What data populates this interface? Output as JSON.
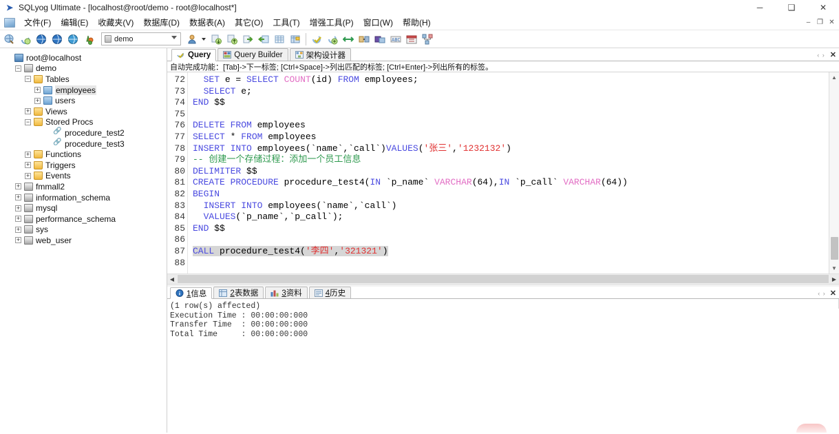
{
  "window": {
    "title": "SQLyog Ultimate - [localhost@root/demo - root@localhost*]",
    "app_icon": "sqlyog-icon",
    "minimize": "─",
    "maximize": "❑",
    "close": "✕",
    "mdi_minimize": "–",
    "mdi_restore": "❐",
    "mdi_close": "✕"
  },
  "menu": {
    "items": [
      {
        "label": "文件(F)",
        "name": "menu-file"
      },
      {
        "label": "编辑(E)",
        "name": "menu-edit"
      },
      {
        "label": "收藏夹(V)",
        "name": "menu-favorites"
      },
      {
        "label": "数据库(D)",
        "name": "menu-database"
      },
      {
        "label": "数据表(A)",
        "name": "menu-table"
      },
      {
        "label": "其它(O)",
        "name": "menu-other"
      },
      {
        "label": "工具(T)",
        "name": "menu-tools"
      },
      {
        "label": "增强工具(P)",
        "name": "menu-powertools"
      },
      {
        "label": "窗口(W)",
        "name": "menu-window"
      },
      {
        "label": "帮助(H)",
        "name": "menu-help"
      }
    ]
  },
  "toolbar": {
    "db_combo_value": "demo",
    "db_combo_placeholder": "demo",
    "buttons": [
      {
        "name": "new-connection-button",
        "icon": "connection-icon"
      },
      {
        "name": "refresh-object-button",
        "icon": "refresh-icon"
      },
      {
        "name": "new-query-tab-button",
        "icon": "globe-blue-icon"
      },
      {
        "name": "open-query-button",
        "icon": "globe-blue2-icon"
      },
      {
        "name": "query-builder-button",
        "icon": "globe-cyan-icon"
      },
      {
        "name": "schema-designer-button",
        "icon": "tree-green-icon"
      }
    ],
    "buttons2": [
      {
        "name": "user-manager-button",
        "icon": "user-icon"
      },
      {
        "name": "import-external-data-button",
        "icon": "import-icon"
      },
      {
        "name": "export-data-button",
        "icon": "export-icon"
      },
      {
        "name": "backup-button",
        "icon": "backup-green-icon"
      },
      {
        "name": "restore-button",
        "icon": "restore-green-icon"
      },
      {
        "name": "table-data-button",
        "icon": "table-grid-icon"
      },
      {
        "name": "table-diagnostics-button",
        "icon": "table-flag-icon"
      }
    ],
    "buttons3": [
      {
        "name": "execute-query-button",
        "icon": "execute-icon"
      },
      {
        "name": "execute-all-button",
        "icon": "execute-all-icon"
      },
      {
        "name": "sync-data-button",
        "icon": "sync-icon"
      },
      {
        "name": "schema-sync-button",
        "icon": "schema-sync-icon"
      },
      {
        "name": "notification-services-button",
        "icon": "notify-icon"
      },
      {
        "name": "sql-formatter-button",
        "icon": "format-icon"
      },
      {
        "name": "scheduled-backup-button",
        "icon": "calendar-icon"
      },
      {
        "name": "migration-button",
        "icon": "migration-icon"
      }
    ]
  },
  "sidebar": {
    "nodes": [
      {
        "label": "root@localhost",
        "indent": 0,
        "expander": "none",
        "icon": "server-icon",
        "name": "tree-node-server"
      },
      {
        "label": "demo",
        "indent": 1,
        "expander": "minus",
        "icon": "db-icon",
        "name": "tree-node-demo"
      },
      {
        "label": "Tables",
        "indent": 2,
        "expander": "minus",
        "icon": "folder-icon",
        "name": "tree-node-tables"
      },
      {
        "label": "employees",
        "indent": 3,
        "expander": "plus",
        "icon": "table-icon",
        "name": "tree-node-employees",
        "selected": true
      },
      {
        "label": "users",
        "indent": 3,
        "expander": "plus",
        "icon": "table-icon",
        "name": "tree-node-users"
      },
      {
        "label": "Views",
        "indent": 2,
        "expander": "plus",
        "icon": "folder-icon",
        "name": "tree-node-views"
      },
      {
        "label": "Stored Procs",
        "indent": 2,
        "expander": "minus",
        "icon": "folder-icon",
        "name": "tree-node-stored-procs"
      },
      {
        "label": "procedure_test2",
        "indent": 4,
        "expander": "none",
        "icon": "proc-icon",
        "name": "tree-node-procedure-test2"
      },
      {
        "label": "procedure_test3",
        "indent": 4,
        "expander": "none",
        "icon": "proc-icon",
        "name": "tree-node-procedure-test3"
      },
      {
        "label": "Functions",
        "indent": 2,
        "expander": "plus",
        "icon": "folder-icon",
        "name": "tree-node-functions"
      },
      {
        "label": "Triggers",
        "indent": 2,
        "expander": "plus",
        "icon": "folder-icon",
        "name": "tree-node-triggers"
      },
      {
        "label": "Events",
        "indent": 2,
        "expander": "plus",
        "icon": "folder-icon",
        "name": "tree-node-events"
      },
      {
        "label": "fmmall2",
        "indent": 1,
        "expander": "plus",
        "icon": "db-icon",
        "name": "tree-node-fmmall2"
      },
      {
        "label": "information_schema",
        "indent": 1,
        "expander": "plus",
        "icon": "db-icon",
        "name": "tree-node-information-schema"
      },
      {
        "label": "mysql",
        "indent": 1,
        "expander": "plus",
        "icon": "db-icon",
        "name": "tree-node-mysql"
      },
      {
        "label": "performance_schema",
        "indent": 1,
        "expander": "plus",
        "icon": "db-icon",
        "name": "tree-node-performance-schema"
      },
      {
        "label": "sys",
        "indent": 1,
        "expander": "plus",
        "icon": "db-icon",
        "name": "tree-node-sys"
      },
      {
        "label": "web_user",
        "indent": 1,
        "expander": "plus",
        "icon": "db-icon",
        "name": "tree-node-web-user"
      }
    ]
  },
  "editor": {
    "tabs": [
      {
        "label": "Query",
        "icon": "query-icon",
        "active": true,
        "name": "tab-query"
      },
      {
        "label": "Query Builder",
        "icon": "query-builder-icon",
        "active": false,
        "name": "tab-query-builder"
      },
      {
        "label": "架构设计器",
        "icon": "schema-designer-icon",
        "active": false,
        "name": "tab-schema-designer"
      }
    ],
    "tab_close_label": "✕",
    "nav_arrows": "‹ ›",
    "hint": "自动完成功能：[Tab]->下一标签; [Ctrl+Space]->列出匹配的标签; [Ctrl+Enter]->列出所有的标签。",
    "first_line_number": 72,
    "lines": [
      {
        "n": 72,
        "tokens": [
          {
            "t": "  ",
            "c": "id"
          },
          {
            "t": "SET",
            "c": "kw"
          },
          {
            "t": " e ",
            "c": "id"
          },
          {
            "t": "=",
            "c": "id"
          },
          {
            "t": " ",
            "c": "id"
          },
          {
            "t": "SELECT",
            "c": "kw"
          },
          {
            "t": " ",
            "c": "id"
          },
          {
            "t": "COUNT",
            "c": "fn"
          },
          {
            "t": "(id) ",
            "c": "id"
          },
          {
            "t": "FROM",
            "c": "kw"
          },
          {
            "t": " employees;",
            "c": "id"
          }
        ]
      },
      {
        "n": 73,
        "tokens": [
          {
            "t": "  ",
            "c": "id"
          },
          {
            "t": "SELECT",
            "c": "kw"
          },
          {
            "t": " e;",
            "c": "id"
          }
        ]
      },
      {
        "n": 74,
        "tokens": [
          {
            "t": "END",
            "c": "kw"
          },
          {
            "t": " $$",
            "c": "id"
          }
        ]
      },
      {
        "n": 75,
        "tokens": [
          {
            "t": "",
            "c": "id"
          }
        ]
      },
      {
        "n": 76,
        "tokens": [
          {
            "t": "DELETE FROM",
            "c": "kw"
          },
          {
            "t": " employees",
            "c": "id"
          }
        ]
      },
      {
        "n": 77,
        "tokens": [
          {
            "t": "SELECT",
            "c": "kw"
          },
          {
            "t": " * ",
            "c": "id"
          },
          {
            "t": "FROM",
            "c": "kw"
          },
          {
            "t": " employees",
            "c": "id"
          }
        ]
      },
      {
        "n": 78,
        "tokens": [
          {
            "t": "INSERT INTO",
            "c": "kw"
          },
          {
            "t": " employees(`name`,`call`)",
            "c": "id"
          },
          {
            "t": "VALUES",
            "c": "kw"
          },
          {
            "t": "(",
            "c": "id"
          },
          {
            "t": "'张三'",
            "c": "str"
          },
          {
            "t": ",",
            "c": "id"
          },
          {
            "t": "'1232132'",
            "c": "str"
          },
          {
            "t": ")",
            "c": "id"
          }
        ]
      },
      {
        "n": 79,
        "tokens": [
          {
            "t": "-- 创建一个存储过程：添加一个员工信息",
            "c": "cm"
          }
        ]
      },
      {
        "n": 80,
        "tokens": [
          {
            "t": "DELIMITER",
            "c": "kw"
          },
          {
            "t": " $$",
            "c": "id"
          }
        ]
      },
      {
        "n": 81,
        "tokens": [
          {
            "t": "CREATE PROCEDURE",
            "c": "kw"
          },
          {
            "t": " procedure_test4(",
            "c": "id"
          },
          {
            "t": "IN",
            "c": "kw"
          },
          {
            "t": " `p_name` ",
            "c": "id"
          },
          {
            "t": "VARCHAR",
            "c": "fn"
          },
          {
            "t": "(64),",
            "c": "id"
          },
          {
            "t": "IN",
            "c": "kw"
          },
          {
            "t": " `p_call` ",
            "c": "id"
          },
          {
            "t": "VARCHAR",
            "c": "fn"
          },
          {
            "t": "(64))",
            "c": "id"
          }
        ]
      },
      {
        "n": 82,
        "tokens": [
          {
            "t": "BEGIN",
            "c": "kw"
          }
        ]
      },
      {
        "n": 83,
        "tokens": [
          {
            "t": "  ",
            "c": "id"
          },
          {
            "t": "INSERT INTO",
            "c": "kw"
          },
          {
            "t": " employees(`name`,`call`)",
            "c": "id"
          }
        ]
      },
      {
        "n": 84,
        "tokens": [
          {
            "t": "  ",
            "c": "id"
          },
          {
            "t": "VALUES",
            "c": "kw"
          },
          {
            "t": "(`p_name`,`p_call`);",
            "c": "id"
          }
        ]
      },
      {
        "n": 85,
        "tokens": [
          {
            "t": "END",
            "c": "kw"
          },
          {
            "t": " $$",
            "c": "id"
          }
        ]
      },
      {
        "n": 86,
        "tokens": [
          {
            "t": "",
            "c": "id"
          }
        ]
      },
      {
        "n": 87,
        "selected": true,
        "tokens": [
          {
            "t": "CALL",
            "c": "kw"
          },
          {
            "t": " procedure_test4(",
            "c": "id"
          },
          {
            "t": "'李四'",
            "c": "str"
          },
          {
            "t": ",",
            "c": "id"
          },
          {
            "t": "'321321'",
            "c": "str"
          },
          {
            "t": ")",
            "c": "id"
          }
        ]
      },
      {
        "n": 88,
        "tokens": [
          {
            "t": "",
            "c": "id"
          }
        ]
      }
    ],
    "scroll_up": "▲",
    "scroll_down": "▼",
    "hscroll_left": "◀",
    "hscroll_right": "▶"
  },
  "results": {
    "tabs": [
      {
        "num": "1",
        "label": "信息",
        "icon": "info-icon",
        "active": true,
        "name": "result-tab-info"
      },
      {
        "num": "2",
        "label": "表数据",
        "icon": "table-data-icon",
        "active": false,
        "name": "result-tab-table-data"
      },
      {
        "num": "3",
        "label": "资料",
        "icon": "profile-icon",
        "active": false,
        "name": "result-tab-profile"
      },
      {
        "num": "4",
        "label": "历史",
        "icon": "history-icon",
        "active": false,
        "name": "result-tab-history"
      }
    ],
    "nav_arrows": "‹ ›",
    "close_label": "✕",
    "messages": [
      "(1 row(s) affected)",
      "Execution Time : 00:00:00:000",
      "Transfer Time  : 00:00:00:000",
      "Total Time     : 00:00:00:000"
    ]
  },
  "colors": {
    "keyword": "#4a4ae0",
    "function": "#e26ec4",
    "string": "#e03030",
    "comment": "#2f9a4f",
    "selection": "#d6d6d6"
  }
}
